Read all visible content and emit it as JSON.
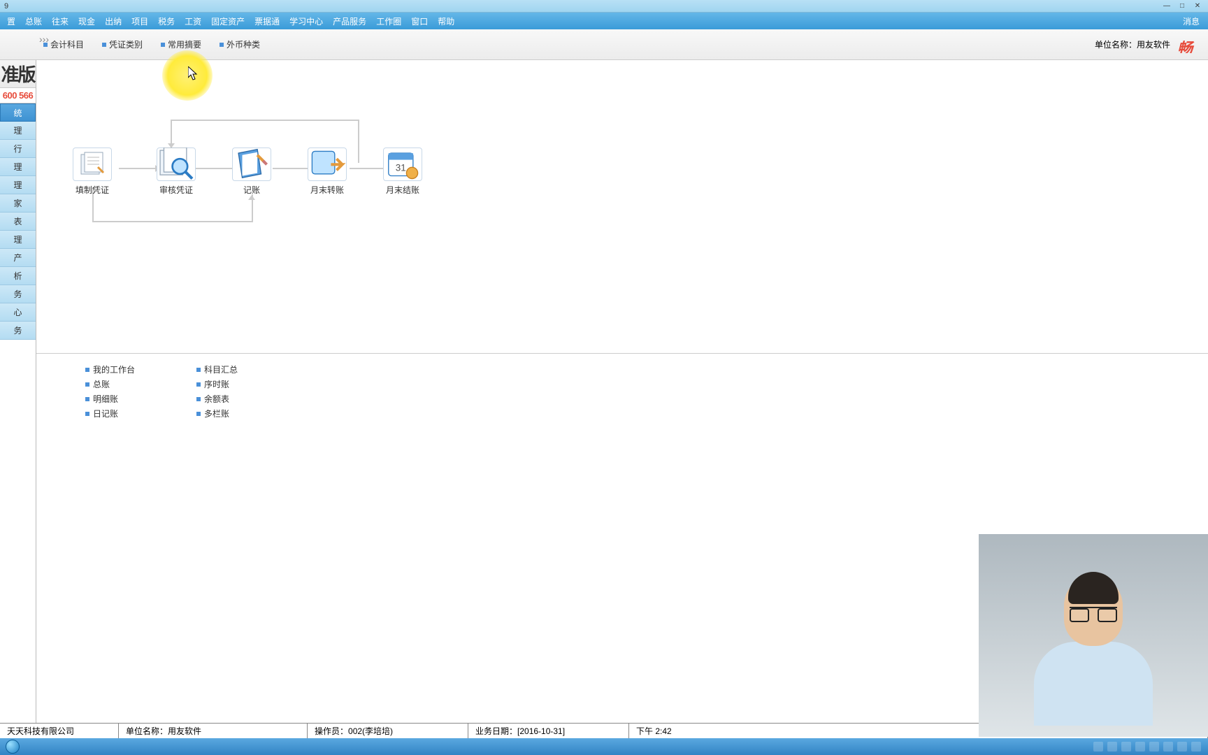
{
  "titlebar": {
    "left_text": "9"
  },
  "menu": [
    "置",
    "总账",
    "往来",
    "现金",
    "出纳",
    "项目",
    "税务",
    "工资",
    "固定资产",
    "票据通",
    "学习中心",
    "产品服务",
    "工作圈",
    "窗口",
    "帮助"
  ],
  "menu_right": "消息",
  "toolbar": {
    "items": [
      "会计科目",
      "凭证类别",
      "常用摘要",
      "外币种类"
    ],
    "unit_label": "单位名称：",
    "unit_value": "用友软件",
    "brand": "畅"
  },
  "sidebar": {
    "head": "准版",
    "phone": "600 566",
    "items": [
      "统",
      "理",
      "行",
      "理",
      "理",
      "家",
      "表",
      "理",
      "产",
      "析",
      "务",
      "心",
      "务"
    ],
    "active_index": 0
  },
  "flow": {
    "nodes": [
      {
        "label": "填制凭证"
      },
      {
        "label": "审核凭证"
      },
      {
        "label": "记账"
      },
      {
        "label": "月末转账"
      },
      {
        "label": "月末结账"
      }
    ]
  },
  "links": {
    "col1": [
      "我的工作台",
      "总账",
      "明细账",
      "日记账"
    ],
    "col2": [
      "科目汇总",
      "序时账",
      "余额表",
      "多栏账"
    ]
  },
  "statusbar": {
    "company": "天天科技有限公司",
    "unit_label": "单位名称：",
    "unit_value": "用友软件",
    "operator_label": "操作员：",
    "operator_value": "002(李培培)",
    "date_label": "业务日期：",
    "date_value": "[2016-10-31]",
    "time": "下午 2:42"
  }
}
